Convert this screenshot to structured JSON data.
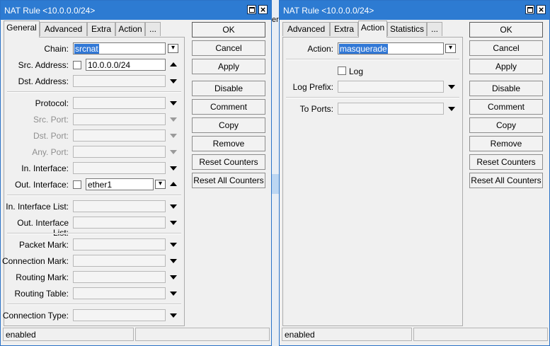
{
  "left_window": {
    "title": "NAT Rule <10.0.0.0/24>",
    "tabs": [
      "General",
      "Advanced",
      "Extra",
      "Action",
      "..."
    ],
    "active_tab": "General",
    "fields": {
      "chain": {
        "label": "Chain:",
        "value": "srcnat"
      },
      "src_address": {
        "label": "Src. Address:",
        "value": "10.0.0.0/24"
      },
      "dst_address": {
        "label": "Dst. Address:"
      },
      "protocol": {
        "label": "Protocol:"
      },
      "src_port": {
        "label": "Src. Port:"
      },
      "dst_port": {
        "label": "Dst. Port:"
      },
      "any_port": {
        "label": "Any. Port:"
      },
      "in_interface": {
        "label": "In. Interface:"
      },
      "out_interface": {
        "label": "Out. Interface:",
        "value": "ether1"
      },
      "in_interface_list": {
        "label": "In. Interface List:"
      },
      "out_interface_list": {
        "label": "Out. Interface List:"
      },
      "packet_mark": {
        "label": "Packet Mark:"
      },
      "connection_mark": {
        "label": "Connection Mark:"
      },
      "routing_mark": {
        "label": "Routing Mark:"
      },
      "routing_table": {
        "label": "Routing Table:"
      },
      "connection_type": {
        "label": "Connection Type:"
      }
    },
    "buttons": [
      "OK",
      "Cancel",
      "Apply",
      "Disable",
      "Comment",
      "Copy",
      "Remove",
      "Reset Counters",
      "Reset All Counters"
    ],
    "status": "enabled"
  },
  "right_window": {
    "title": "NAT Rule <10.0.0.0/24>",
    "tabs": [
      "Advanced",
      "Extra",
      "Action",
      "Statistics",
      "..."
    ],
    "active_tab": "Action",
    "fields": {
      "action": {
        "label": "Action:",
        "value": "masquerade"
      },
      "log": {
        "label": "Log"
      },
      "log_prefix": {
        "label": "Log Prefix:"
      },
      "to_ports": {
        "label": "To Ports:"
      }
    },
    "buttons": [
      "OK",
      "Cancel",
      "Apply",
      "Disable",
      "Comment",
      "Copy",
      "Remove",
      "Reset Counters",
      "Reset All Counters"
    ],
    "status": "enabled"
  },
  "background_fragment": "er."
}
